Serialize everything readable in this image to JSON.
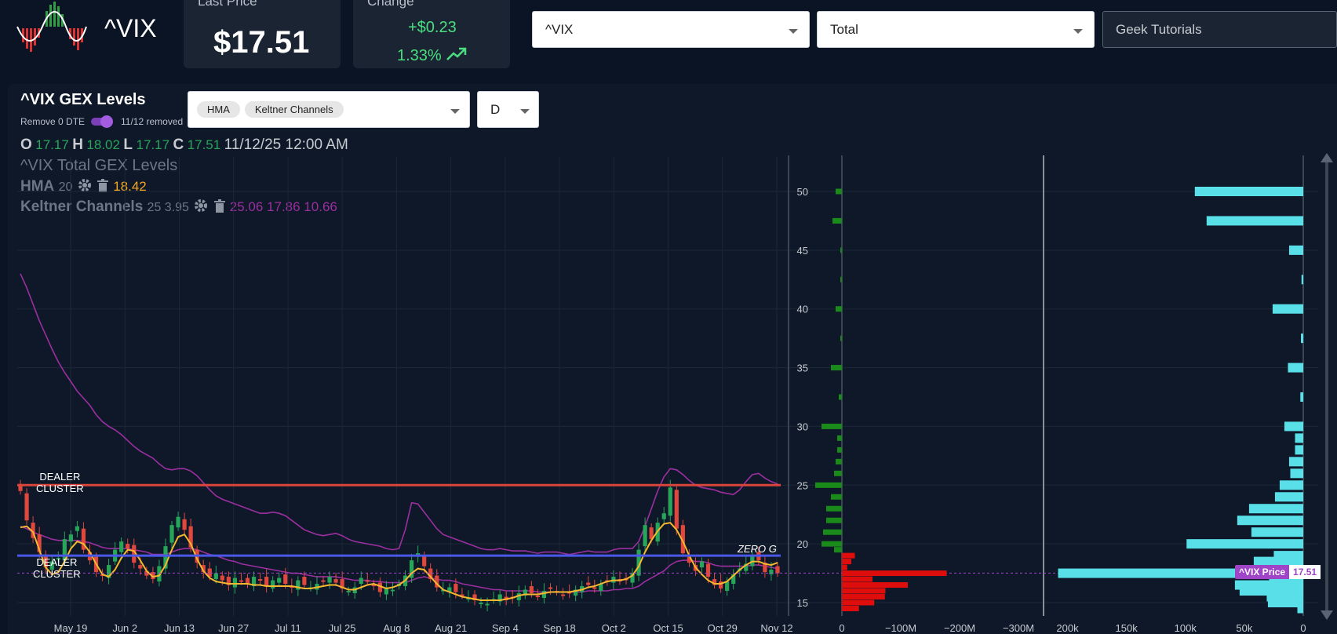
{
  "header": {
    "ticker": "^VIX",
    "last_price_label": "Last Price",
    "last_price": "$17.51",
    "change_label": "Change",
    "change_abs": "+$0.23",
    "change_pct": "1.33%",
    "symbol_select": "^VIX",
    "type_select": "Total",
    "tutorial_select": "Geek Tutorials"
  },
  "panel": {
    "title": "^VIX GEX Levels",
    "toggle_label": "Remove 0 DTE",
    "toggle_on": true,
    "removed_count": "11/12 removed",
    "indicator_pills": [
      "HMA",
      "Keltner Channels"
    ],
    "timeframe": "D"
  },
  "ohlc": {
    "o_label": "O",
    "o": "17.17",
    "h_label": "H",
    "h": "18.02",
    "l_label": "L",
    "l": "17.17",
    "c_label": "C",
    "c": "17.51",
    "datetime": "11/12/25 12:00 AM"
  },
  "legend": {
    "title": "^VIX Total GEX Levels",
    "hma_name": "HMA",
    "hma_param": "20",
    "hma_value": "18.42",
    "kc_name": "Keltner Channels",
    "kc_params": "25 3.95",
    "kc_values": "25.06 17.86 10.66"
  },
  "annotations": {
    "dealer_cluster_upper": [
      "DEALER",
      "CLUSTER"
    ],
    "dealer_cluster_lower": [
      "DEALER",
      "CLUSTER"
    ],
    "zero_gamma": "ZERO G",
    "price_tag_label": "^VIX Price",
    "price_tag_value": "17.51"
  },
  "colors": {
    "bull": "#27a65a",
    "bear": "#e0483e",
    "hma": "#f5b82e",
    "keltner": "#9c2fa0",
    "dealer_upper_line": "#d9453a",
    "dealer_lower_line": "#4a57e8",
    "gex_positive": "#1a8a1a",
    "gex_negative": "#e00d0d",
    "oi_bar": "#59dfe8",
    "price_tag": "#a044c8"
  },
  "chart_data": [
    {
      "type": "candlestick",
      "x_labels": [
        "May 19",
        "Jun 2",
        "Jun 13",
        "Jun 27",
        "Jul 11",
        "Jul 25",
        "Aug 8",
        "Aug 21",
        "Sep 4",
        "Sep 18",
        "Oct 2",
        "Oct 15",
        "Oct 29",
        "Nov 12"
      ],
      "ylim": [
        14,
        52
      ],
      "y_ticks": [
        15,
        20,
        25,
        30,
        35,
        40,
        45,
        50
      ],
      "closes": [
        24.5,
        22.0,
        20.5,
        19.3,
        18.0,
        18.5,
        18.8,
        20.4,
        20.8,
        21.5,
        19.5,
        18.6,
        17.6,
        17.3,
        18.2,
        19.5,
        20.2,
        19.6,
        18.4,
        17.9,
        17.3,
        17.0,
        18.1,
        19.8,
        21.6,
        22.3,
        21.2,
        19.7,
        18.4,
        17.6,
        17.2,
        17.5,
        16.9,
        16.5,
        17.1,
        16.8,
        16.6,
        17.2,
        16.9,
        16.4,
        16.9,
        17.1,
        16.6,
        16.3,
        16.9,
        16.5,
        16.3,
        16.6,
        16.9,
        17.2,
        16.7,
        16.2,
        16.0,
        16.3,
        17.1,
        16.8,
        16.4,
        15.9,
        16.3,
        16.1,
        16.6,
        17.3,
        18.6,
        19.2,
        18.1,
        17.0,
        16.3,
        16.1,
        16.3,
        15.9,
        15.6,
        15.4,
        15.2,
        15.0,
        14.9,
        15.3,
        15.7,
        15.2,
        15.4,
        15.8,
        16.1,
        15.8,
        15.6,
        16.0,
        16.2,
        15.9,
        15.6,
        15.8,
        16.1,
        16.4,
        16.5,
        16.2,
        16.6,
        16.9,
        17.2,
        16.8,
        16.9,
        17.5,
        19.5,
        21.6,
        20.4,
        21.8,
        22.6,
        24.8,
        21.3,
        19.2,
        18.4,
        17.7,
        18.5,
        17.2,
        16.5,
        16.2,
        16.8,
        17.4,
        17.9,
        18.3,
        19.0,
        18.6,
        17.6,
        17.8,
        17.5
      ],
      "hma": [
        21.4,
        21.5,
        21.0,
        19.5,
        18.0,
        17.4,
        17.6,
        18.5,
        19.6,
        20.2,
        20.0,
        19.3,
        18.3,
        17.4,
        17.2,
        17.8,
        18.8,
        19.5,
        19.4,
        18.6,
        17.7,
        17.2,
        17.3,
        18.2,
        19.5,
        20.6,
        20.8,
        20.0,
        18.7,
        17.7,
        17.1,
        16.8,
        16.7,
        16.6,
        16.6,
        16.6,
        16.6,
        16.5,
        16.5,
        16.4,
        16.4,
        16.4,
        16.4,
        16.4,
        16.3,
        16.2,
        16.2,
        16.3,
        16.4,
        16.5,
        16.5,
        16.3,
        16.1,
        16.1,
        16.3,
        16.5,
        16.6,
        16.4,
        16.2,
        16.3,
        16.5,
        16.9,
        17.5,
        17.9,
        17.8,
        17.2,
        16.6,
        16.1,
        15.9,
        15.7,
        15.5,
        15.4,
        15.3,
        15.2,
        15.2,
        15.2,
        15.2,
        15.3,
        15.4,
        15.6,
        15.7,
        15.7,
        15.7,
        15.8,
        15.9,
        15.9,
        15.9,
        15.9,
        16.0,
        16.1,
        16.3,
        16.4,
        16.6,
        16.8,
        16.9,
        16.9,
        17.0,
        17.3,
        18.1,
        19.3,
        20.3,
        21.1,
        21.7,
        21.8,
        21.2,
        20.2,
        19.0,
        18.0,
        17.4,
        16.9,
        16.6,
        16.6,
        16.8,
        17.3,
        17.8,
        18.2,
        18.5,
        18.5,
        18.3,
        18.2,
        18.4
      ],
      "keltner_upper": [
        43.0,
        41.8,
        40.4,
        39.0,
        37.8,
        36.6,
        35.5,
        34.6,
        33.8,
        33.0,
        32.4,
        31.8,
        31.0,
        30.4,
        30.0,
        29.7,
        29.3,
        28.8,
        28.3,
        27.9,
        27.6,
        27.3,
        26.8,
        26.4,
        26.3,
        26.4,
        26.4,
        26.2,
        25.8,
        25.2,
        24.6,
        24.1,
        23.8,
        23.6,
        23.4,
        23.2,
        23.0,
        22.8,
        22.6,
        22.6,
        22.7,
        22.6,
        22.4,
        22.0,
        21.6,
        21.2,
        21.0,
        20.8,
        20.7,
        20.8,
        20.9,
        20.7,
        20.4,
        20.2,
        20.1,
        20.0,
        19.9,
        19.8,
        19.6,
        19.5,
        19.6,
        21.2,
        23.5,
        23.4,
        22.7,
        22.0,
        21.3,
        20.8,
        20.6,
        20.4,
        20.2,
        20.0,
        19.8,
        19.6,
        19.5,
        19.5,
        19.6,
        19.5,
        19.4,
        19.4,
        19.4,
        19.3,
        19.2,
        19.3,
        19.3,
        19.3,
        19.2,
        19.1,
        19.2,
        19.3,
        19.4,
        19.3,
        19.3,
        19.3,
        19.5,
        19.6,
        19.6,
        19.6,
        20.2,
        21.5,
        23.0,
        24.5,
        25.7,
        26.4,
        26.3,
        25.9,
        25.4,
        25.0,
        24.8,
        24.7,
        24.6,
        24.4,
        24.3,
        24.2,
        24.6,
        25.3,
        25.9,
        26.0,
        25.6,
        25.3,
        25.1
      ],
      "keltner_middle": [
        21.5,
        21.3,
        21.0,
        20.8,
        20.6,
        20.4,
        20.3,
        20.3,
        20.3,
        20.3,
        20.2,
        20.1,
        19.9,
        19.7,
        19.6,
        19.6,
        19.6,
        19.6,
        19.5,
        19.4,
        19.3,
        19.1,
        19.1,
        19.1,
        19.3,
        19.5,
        19.6,
        19.6,
        19.5,
        19.3,
        19.1,
        19.0,
        18.8,
        18.6,
        18.5,
        18.3,
        18.2,
        18.1,
        18.0,
        17.9,
        17.8,
        17.7,
        17.6,
        17.5,
        17.5,
        17.4,
        17.3,
        17.2,
        17.2,
        17.2,
        17.2,
        17.1,
        17.0,
        16.9,
        16.9,
        16.9,
        16.8,
        16.8,
        16.7,
        16.7,
        16.7,
        16.7,
        16.9,
        17.1,
        17.2,
        17.1,
        17.0,
        16.9,
        16.9,
        16.8,
        16.6,
        16.5,
        16.4,
        16.3,
        16.2,
        16.1,
        16.1,
        16.0,
        16.0,
        16.0,
        16.0,
        16.0,
        15.9,
        15.9,
        15.9,
        15.9,
        15.9,
        15.9,
        15.9,
        15.9,
        16.0,
        16.0,
        16.0,
        16.0,
        16.1,
        16.1,
        16.2,
        16.2,
        16.4,
        16.8,
        17.1,
        17.4,
        17.7,
        18.2,
        18.5,
        18.6,
        18.6,
        18.5,
        18.5,
        18.4,
        18.2,
        18.1,
        18.1,
        18.1,
        18.1,
        18.1,
        18.2,
        18.2,
        18.1,
        18.0,
        17.9
      ],
      "horizontal_levels": [
        {
          "label": "DEALER CLUSTER",
          "value": 25.0
        },
        {
          "label": "DEALER CLUSTER",
          "value": 19.0
        },
        {
          "label": "ZERO G",
          "value": 19.0
        }
      ],
      "current_price": 17.51
    },
    {
      "type": "bar",
      "orientation": "horizontal",
      "x_ticks": [
        "0",
        "−100M",
        "−200M",
        "−300M"
      ],
      "y_ticks": [
        15,
        20,
        25,
        30,
        35,
        40,
        45,
        50
      ],
      "strikes": [
        50,
        47.5,
        45,
        42.5,
        40,
        37.5,
        35,
        32.5,
        30,
        29,
        28,
        27,
        26,
        25,
        24,
        23,
        22,
        21,
        20,
        19.5,
        19,
        18.5,
        18,
        17.5,
        17,
        16.5,
        16,
        15.5,
        15,
        14.5
      ],
      "gex_values": [
        4,
        6,
        1,
        1,
        4,
        1,
        7,
        2,
        13,
        3,
        3,
        4,
        5,
        17,
        7,
        10,
        10,
        12,
        13,
        5,
        -22,
        -16,
        -9,
        -178,
        -52,
        -112,
        -74,
        -73,
        -55,
        -29
      ]
    },
    {
      "type": "bar",
      "orientation": "horizontal",
      "x_ticks": [
        "200k",
        "150k",
        "100k",
        "50k",
        "0"
      ],
      "y_ticks": [
        15,
        20,
        25,
        30,
        35,
        40,
        45,
        50
      ],
      "strikes": [
        50,
        47.5,
        45,
        42.5,
        40,
        37.5,
        35,
        32.5,
        30,
        29,
        28,
        27,
        26,
        25,
        24,
        23,
        22,
        21,
        20,
        19,
        18.5,
        18,
        17.5,
        17,
        16.5,
        16,
        15.5,
        15,
        14.5
      ],
      "oi_values": [
        92000,
        82000,
        12000,
        1500,
        26000,
        2000,
        13000,
        2500,
        16000,
        7000,
        7000,
        12000,
        11000,
        20000,
        24000,
        46000,
        56000,
        44000,
        99000,
        25000,
        42000,
        4000,
        208000,
        29000,
        58000,
        54000,
        31000,
        30000,
        5000
      ]
    }
  ]
}
